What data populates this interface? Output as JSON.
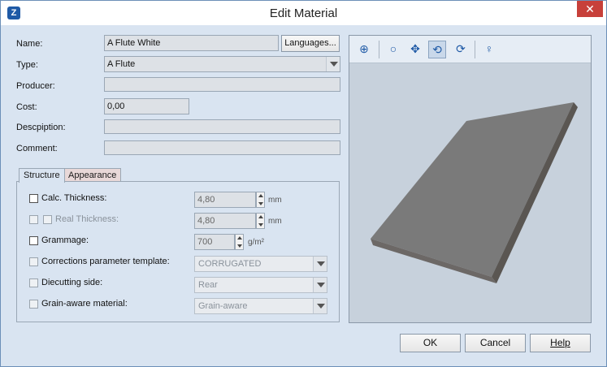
{
  "window": {
    "title": "Edit Material",
    "app_icon": "Z"
  },
  "form": {
    "name_label": "Name:",
    "name_value": "A Flute White",
    "languages_button": "Languages...",
    "type_label": "Type:",
    "type_value": "A Flute",
    "producer_label": "Producer:",
    "producer_value": "",
    "cost_label": "Cost:",
    "cost_value": "0,00",
    "description_label": "Descpiption:",
    "description_value": "",
    "comment_label": "Comment:",
    "comment_value": ""
  },
  "tabs": {
    "structure": "Structure",
    "appearance": "Appearance"
  },
  "structure": {
    "calc_thickness_label": "Calc. Thickness:",
    "calc_thickness_value": "4,80",
    "calc_thickness_unit": "mm",
    "real_thickness_label": "Real Thickness:",
    "real_thickness_value": "4,80",
    "real_thickness_unit": "mm",
    "grammage_label": "Grammage:",
    "grammage_value": "700",
    "grammage_unit": "g/m²",
    "corrections_label": "Corrections parameter template:",
    "corrections_value": "CORRUGATED",
    "diecutting_label": "Diecutting side:",
    "diecutting_value": "Rear",
    "grain_label": "Grain-aware material:",
    "grain_value": "Grain-aware"
  },
  "viewer_toolbar": [
    "zoom-fit-icon",
    "zoom-icon",
    "pan-icon",
    "rotate-icon",
    "orbit-icon",
    "lightbulb-icon"
  ],
  "buttons": {
    "ok": "OK",
    "cancel": "Cancel",
    "help": "Help"
  },
  "colors": {
    "close_button": "#c7403a",
    "dialog_bg": "#d9e4f1",
    "viewer_bg": "#c7d1dc",
    "board_top": "#7a7a7a"
  }
}
